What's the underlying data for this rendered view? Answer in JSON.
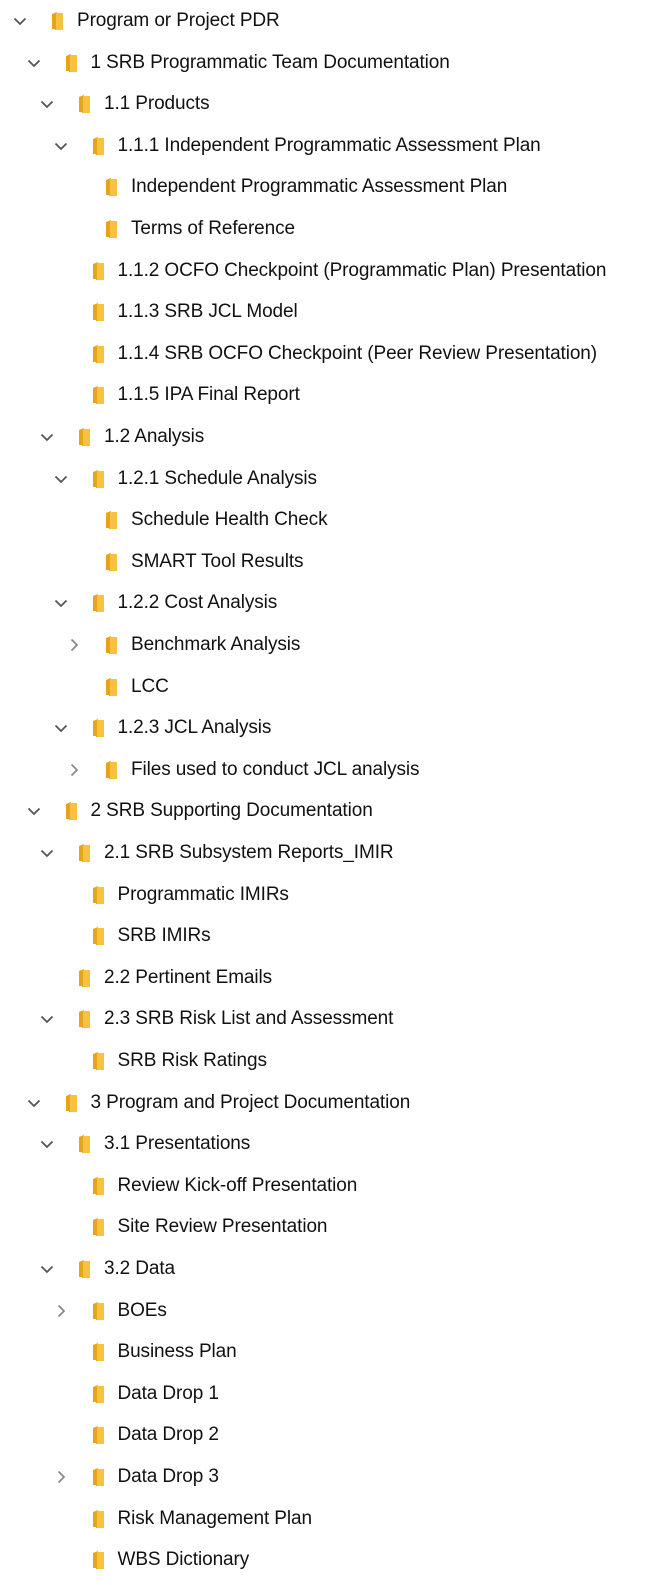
{
  "tree": {
    "items": [
      {
        "id": "program-or-project-pdr",
        "label": "Program or Project PDR",
        "level": 0,
        "state": "expanded"
      },
      {
        "id": "srb-programmatic-team-documentation",
        "label": "1 SRB Programmatic Team Documentation",
        "level": 1,
        "state": "expanded"
      },
      {
        "id": "products",
        "label": "1.1 Products",
        "level": 2,
        "state": "expanded"
      },
      {
        "id": "independent-programmatic-assessment-plan-group",
        "label": "1.1.1 Independent Programmatic Assessment Plan",
        "level": 3,
        "state": "expanded"
      },
      {
        "id": "independent-programmatic-assessment-plan",
        "label": "Independent Programmatic Assessment Plan",
        "level": 4,
        "state": "none"
      },
      {
        "id": "terms-of-reference",
        "label": "Terms of Reference",
        "level": 4,
        "state": "none"
      },
      {
        "id": "ocfo-checkpoint-programmatic-plan-presentation",
        "label": "1.1.2 OCFO Checkpoint (Programmatic Plan) Presentation",
        "level": 3,
        "state": "none"
      },
      {
        "id": "srb-jcl-model",
        "label": "1.1.3 SRB JCL Model",
        "level": 3,
        "state": "none"
      },
      {
        "id": "srb-ocfo-checkpoint-peer-review-presentation",
        "label": "1.1.4 SRB OCFO Checkpoint (Peer Review Presentation)",
        "level": 3,
        "state": "none"
      },
      {
        "id": "ipa-final-report",
        "label": "1.1.5 IPA Final Report",
        "level": 3,
        "state": "none"
      },
      {
        "id": "analysis",
        "label": "1.2 Analysis",
        "level": 2,
        "state": "expanded"
      },
      {
        "id": "schedule-analysis",
        "label": "1.2.1 Schedule Analysis",
        "level": 3,
        "state": "expanded"
      },
      {
        "id": "schedule-health-check",
        "label": "Schedule Health Check",
        "level": 4,
        "state": "none"
      },
      {
        "id": "smart-tool-results",
        "label": "SMART Tool Results",
        "level": 4,
        "state": "none"
      },
      {
        "id": "cost-analysis",
        "label": "1.2.2 Cost Analysis",
        "level": 3,
        "state": "expanded"
      },
      {
        "id": "benchmark-analysis",
        "label": "Benchmark Analysis",
        "level": 4,
        "state": "collapsed"
      },
      {
        "id": "lcc",
        "label": "LCC",
        "level": 4,
        "state": "none"
      },
      {
        "id": "jcl-analysis",
        "label": "1.2.3 JCL Analysis",
        "level": 3,
        "state": "expanded"
      },
      {
        "id": "files-used-to-conduct-jcl-analysis",
        "label": "Files used to conduct JCL analysis",
        "level": 4,
        "state": "collapsed"
      },
      {
        "id": "srb-supporting-documentation",
        "label": "2 SRB Supporting Documentation",
        "level": 1,
        "state": "expanded"
      },
      {
        "id": "srb-subsystem-reports-imir",
        "label": "2.1 SRB Subsystem Reports_IMIR",
        "level": 2,
        "state": "expanded"
      },
      {
        "id": "programmatic-imirs",
        "label": "Programmatic IMIRs",
        "level": 3,
        "state": "none"
      },
      {
        "id": "srb-imirs",
        "label": "SRB IMIRs",
        "level": 3,
        "state": "none"
      },
      {
        "id": "pertinent-emails",
        "label": "2.2 Pertinent Emails",
        "level": 2,
        "state": "none"
      },
      {
        "id": "srb-risk-list-and-assessment",
        "label": "2.3 SRB Risk List and Assessment",
        "level": 2,
        "state": "expanded"
      },
      {
        "id": "srb-risk-ratings",
        "label": "SRB Risk Ratings",
        "level": 3,
        "state": "none"
      },
      {
        "id": "program-and-project-documentation",
        "label": "3 Program and Project Documentation",
        "level": 1,
        "state": "expanded"
      },
      {
        "id": "presentations",
        "label": "3.1 Presentations",
        "level": 2,
        "state": "expanded"
      },
      {
        "id": "review-kick-off-presentation",
        "label": "Review Kick-off Presentation",
        "level": 3,
        "state": "none"
      },
      {
        "id": "site-review-presentation",
        "label": "Site Review Presentation",
        "level": 3,
        "state": "none"
      },
      {
        "id": "data",
        "label": "3.2 Data",
        "level": 2,
        "state": "expanded"
      },
      {
        "id": "boes",
        "label": "BOEs",
        "level": 3,
        "state": "collapsed"
      },
      {
        "id": "business-plan",
        "label": "Business Plan",
        "level": 3,
        "state": "none"
      },
      {
        "id": "data-drop-1",
        "label": "Data Drop 1",
        "level": 3,
        "state": "none"
      },
      {
        "id": "data-drop-2",
        "label": "Data Drop 2",
        "level": 3,
        "state": "none"
      },
      {
        "id": "data-drop-3",
        "label": "Data Drop 3",
        "level": 3,
        "state": "collapsed"
      },
      {
        "id": "risk-management-plan",
        "label": "Risk Management Plan",
        "level": 3,
        "state": "none"
      },
      {
        "id": "wbs-dictionary",
        "label": "WBS Dictionary",
        "level": 3,
        "state": "none"
      }
    ]
  },
  "icons": {
    "folder": "folder-icon",
    "expanded": "chevron-down-icon",
    "collapsed": "chevron-right-icon"
  },
  "colors": {
    "folder_front": "#F7C23F",
    "folder_back": "#E9A319",
    "chevron": "#555555",
    "text": "#111111",
    "background": "#FFFFFF"
  }
}
